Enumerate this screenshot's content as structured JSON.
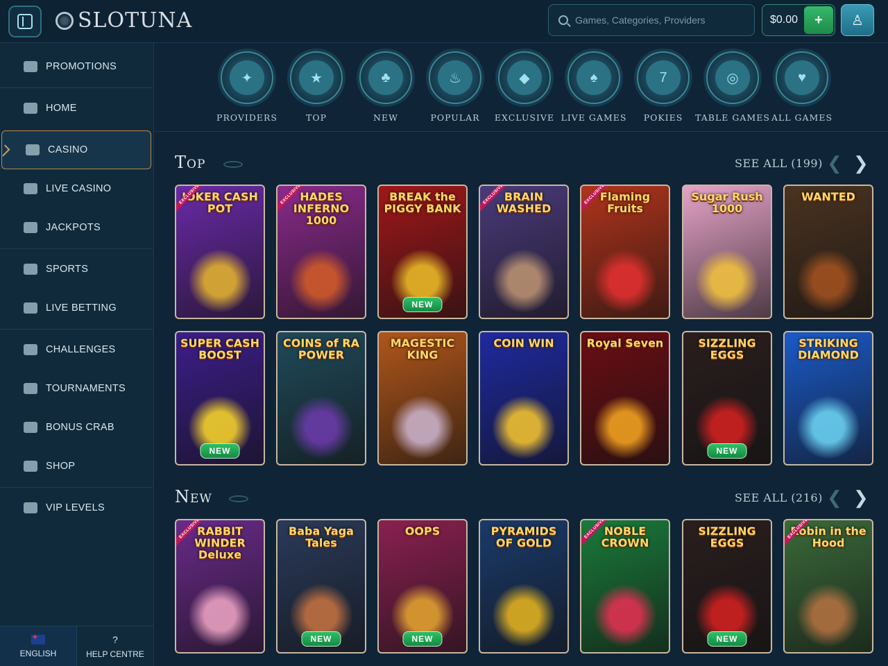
{
  "header": {
    "logo_text": "SLOTUNA",
    "search_placeholder": "Games, Categories, Providers",
    "balance": "$0.00",
    "deposit_icon": "coin-plus-icon",
    "profile_icon": "user-icon"
  },
  "sidebar": {
    "items": [
      {
        "label": "PROMOTIONS",
        "icon": "promotions-icon"
      },
      {
        "label": "HOME",
        "icon": "castle-icon"
      },
      {
        "label": "CASINO",
        "icon": "slot-machine-icon",
        "active": true
      },
      {
        "label": "LIVE CASINO",
        "icon": "live-casino-icon"
      },
      {
        "label": "JACKPOTS",
        "icon": "clover-icon"
      },
      {
        "label": "SPORTS",
        "icon": "ball-icon"
      },
      {
        "label": "LIVE BETTING",
        "icon": "live-tag-icon"
      },
      {
        "label": "CHALLENGES",
        "icon": "target-icon"
      },
      {
        "label": "TOURNAMENTS",
        "icon": "trophy-icon"
      },
      {
        "label": "BONUS CRAB",
        "icon": "crab-claw-icon"
      },
      {
        "label": "SHOP",
        "icon": "shop-icon"
      },
      {
        "label": "VIP LEVELS",
        "icon": "diamond-icon"
      }
    ],
    "footer": {
      "language": "ENGLISH",
      "help": "HELP CENTRE"
    }
  },
  "categories": [
    {
      "label": "PROVIDERS",
      "glyph": "✦"
    },
    {
      "label": "TOP",
      "glyph": "★"
    },
    {
      "label": "NEW",
      "glyph": "♣"
    },
    {
      "label": "POPULAR",
      "glyph": "♨"
    },
    {
      "label": "EXCLUSIVE",
      "glyph": "◆"
    },
    {
      "label": "LIVE GAMES",
      "glyph": "♠"
    },
    {
      "label": "POKIES",
      "glyph": "7"
    },
    {
      "label": "TABLE GAMES",
      "glyph": "◎"
    },
    {
      "label": "ALL GAMES",
      "glyph": "♥"
    }
  ],
  "sections": [
    {
      "title": "Top",
      "see_all": "SEE ALL (199)",
      "rows": [
        [
          {
            "name": "JOKER CASH POT",
            "bg": "#6a2aa8",
            "art": "#e0b030",
            "exclusive": true
          },
          {
            "name": "HADES INFERNO 1000",
            "bg": "#8a2a8a",
            "art": "#d05a2a",
            "exclusive": true
          },
          {
            "name": "BREAK the PIGGY BANK",
            "bg": "#a0171a",
            "art": "#e8b825",
            "new": true
          },
          {
            "name": "BRAIN WASHED",
            "bg": "#4a3a7a",
            "art": "#b89070",
            "exclusive": true
          },
          {
            "name": "Flaming Fruits",
            "bg": "#b0341c",
            "art": "#e03030",
            "exclusive": true
          },
          {
            "name": "Sugar Rush 1000",
            "bg": "#e6a3c8",
            "art": "#f0c040"
          },
          {
            "name": "WANTED",
            "bg": "#4a3320",
            "art": "#a05020"
          }
        ],
        [
          {
            "name": "SUPER CASH BOOST",
            "bg": "#3c1e8a",
            "art": "#f3d12c",
            "new": true
          },
          {
            "name": "COINS of RA POWER",
            "bg": "#1f4a5a",
            "art": "#6a3aa8"
          },
          {
            "name": "MAGESTIC KING",
            "bg": "#b0561a",
            "art": "#c9b0c8"
          },
          {
            "name": "COIN WIN",
            "bg": "#1e2aa0",
            "art": "#f0c030"
          },
          {
            "name": "Royal Seven",
            "bg": "#6a0e14",
            "art": "#f0a020"
          },
          {
            "name": "SIZZLING EGGS",
            "bg": "#2a1e1e",
            "art": "#d02020",
            "new": true
          },
          {
            "name": "STRIKING DIAMOND",
            "bg": "#1a5ac8",
            "art": "#6ad0f0"
          }
        ]
      ]
    },
    {
      "title": "New",
      "see_all": "SEE ALL (216)",
      "rows": [
        [
          {
            "name": "RABBIT WINDER Deluxe",
            "bg": "#6a2a8a",
            "art": "#e8a0c0",
            "exclusive": true
          },
          {
            "name": "Baba Yaga Tales",
            "bg": "#2a3a5a",
            "art": "#c07040",
            "new": true
          },
          {
            "name": "OOPS",
            "bg": "#8a2050",
            "art": "#e0a030",
            "new": true
          },
          {
            "name": "PYRAMIDS OF GOLD",
            "bg": "#1a3a6a",
            "art": "#e0b020"
          },
          {
            "name": "NOBLE CROWN",
            "bg": "#1a7a3a",
            "art": "#e03050",
            "exclusive": true
          },
          {
            "name": "SIZZLING EGGS",
            "bg": "#2a1e1e",
            "art": "#d02020",
            "new": true
          },
          {
            "name": "Robin in the Hood",
            "bg": "#3a6a3a",
            "art": "#b07040",
            "exclusive": true
          }
        ]
      ]
    }
  ],
  "labels": {
    "new_tag": "NEW",
    "exclusive_tag": "EXCLUSIVE"
  }
}
